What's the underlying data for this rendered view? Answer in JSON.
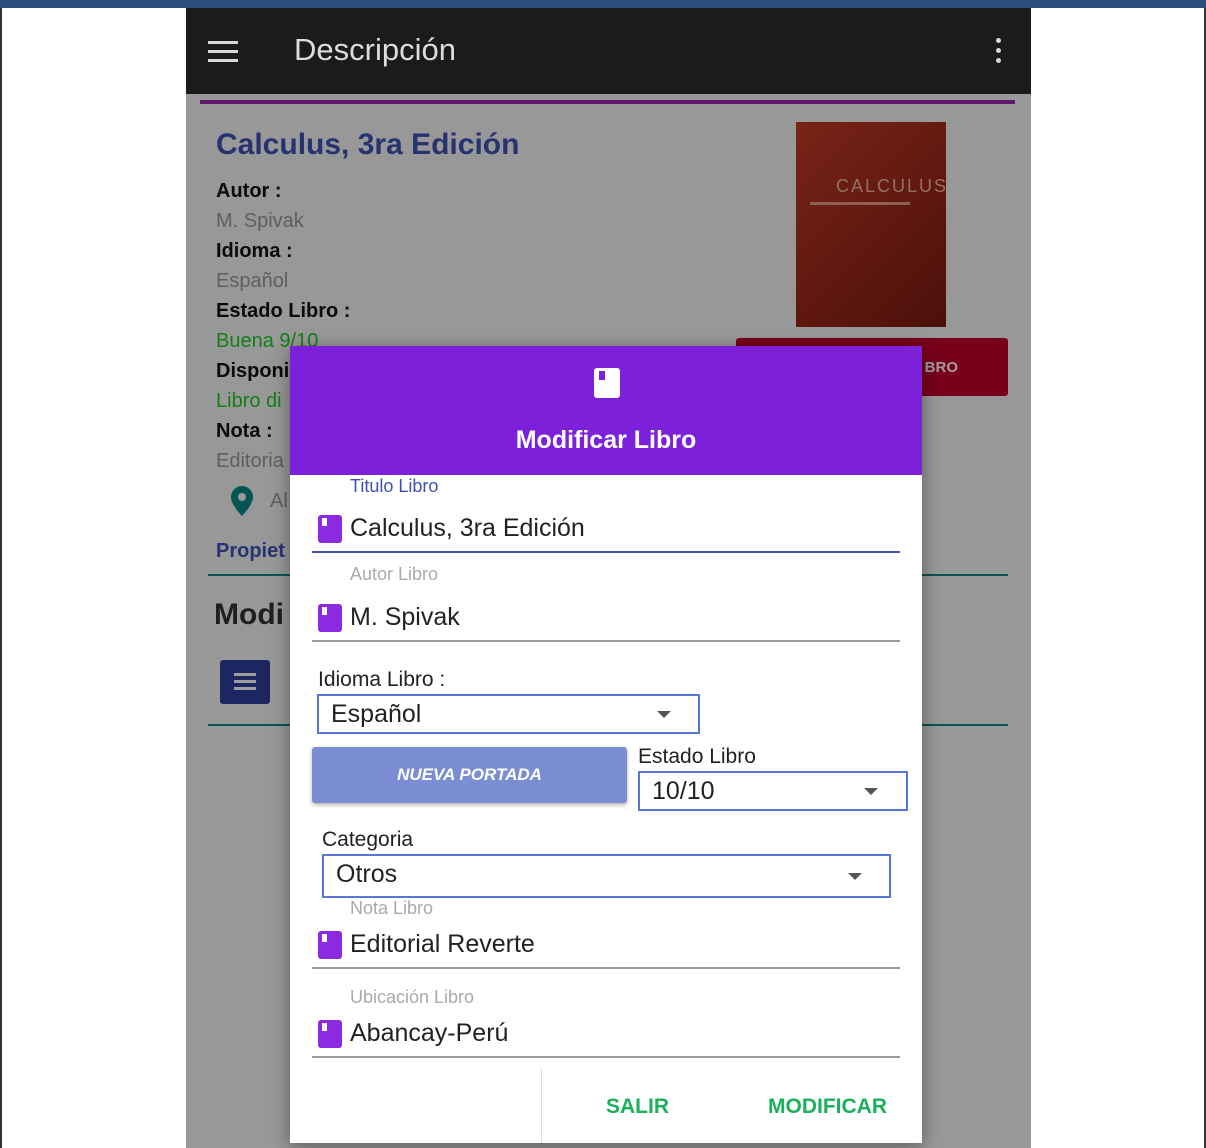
{
  "app": {
    "title": "Descripción"
  },
  "book": {
    "title": "Calculus, 3ra Edición",
    "autor_label": "Autor :",
    "autor_value": "M. Spivak",
    "idioma_label": "Idioma :",
    "idioma_value": "Español",
    "estado_label": "Estado Libro :",
    "estado_value": "Buena 9/10",
    "disponible_label": "Disponi",
    "disponible_value": "Libro di",
    "nota_label": "Nota :",
    "nota_value": "Editoria",
    "ubicacion_value": "Al",
    "propietario_label": "Propiet",
    "cover_text": "CALCULUS",
    "red_button_label": "BRO",
    "modificar_heading": "Modi"
  },
  "dialog": {
    "title": "Modificar Libro",
    "titulo_label": "Titulo Libro",
    "titulo_value": "Calculus, 3ra Edición",
    "autor_label": "Autor Libro",
    "autor_value": "M. Spivak",
    "idioma_label": "Idioma Libro :",
    "idioma_selected": "Español",
    "portada_button": "NUEVA PORTADA",
    "estado_label": "Estado Libro",
    "estado_selected": "10/10",
    "categoria_label": "Categoria",
    "categoria_selected": "Otros",
    "nota_label": "Nota Libro",
    "nota_value": "Editorial Reverte",
    "ubicacion_label": "Ubicación Libro",
    "ubicacion_value": "Abancay-Perú",
    "salir_button": "SALIR",
    "modificar_button": "MODIFICAR"
  },
  "colors": {
    "appbar": "#1b1b1b",
    "dialog_header": "#7c21d9",
    "accent_blue": "#3f51b5",
    "action_green": "#1bb05a",
    "status_green": "#22cc22",
    "red_button": "#c2002d"
  }
}
